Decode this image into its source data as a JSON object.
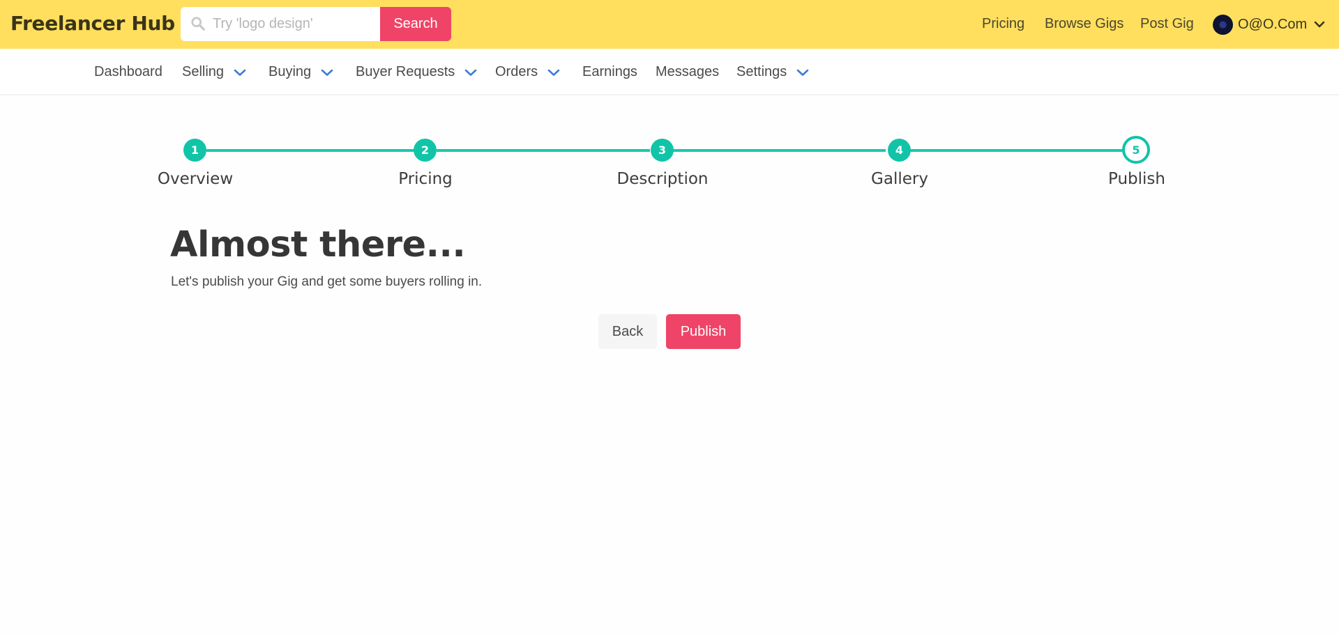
{
  "app": {
    "brand": "Freelancer Hub",
    "colors": {
      "header_bg": "#ffdf5d",
      "accent": "#ef4467",
      "step": "#11c4a8"
    }
  },
  "search": {
    "placeholder": "Try 'logo design'",
    "value": "",
    "button_label": "Search",
    "icon": "search-icon"
  },
  "top_nav": {
    "links": [
      "Pricing",
      "Browse Gigs",
      "Post Gig"
    ],
    "account_label": "O@O.Com",
    "account_icon": "chevron-down-icon"
  },
  "sub_nav": {
    "items": [
      {
        "label": "Dashboard",
        "dropdown": false
      },
      {
        "label": "Selling",
        "dropdown": true
      },
      {
        "label": "Buying",
        "dropdown": true
      },
      {
        "label": "Buyer Requests",
        "dropdown": true
      },
      {
        "label": "Orders",
        "dropdown": true
      },
      {
        "label": "Earnings",
        "dropdown": false
      },
      {
        "label": "Messages",
        "dropdown": false
      },
      {
        "label": "Settings",
        "dropdown": true
      }
    ]
  },
  "steps": [
    {
      "number": "1",
      "label": "Overview",
      "state": "done"
    },
    {
      "number": "2",
      "label": "Pricing",
      "state": "done"
    },
    {
      "number": "3",
      "label": "Description",
      "state": "done"
    },
    {
      "number": "4",
      "label": "Gallery",
      "state": "done"
    },
    {
      "number": "5",
      "label": "Publish",
      "state": "current"
    }
  ],
  "main": {
    "heading": "Almost there...",
    "subtext": "Let's publish your Gig and get some buyers rolling in.",
    "back_label": "Back",
    "publish_label": "Publish"
  }
}
